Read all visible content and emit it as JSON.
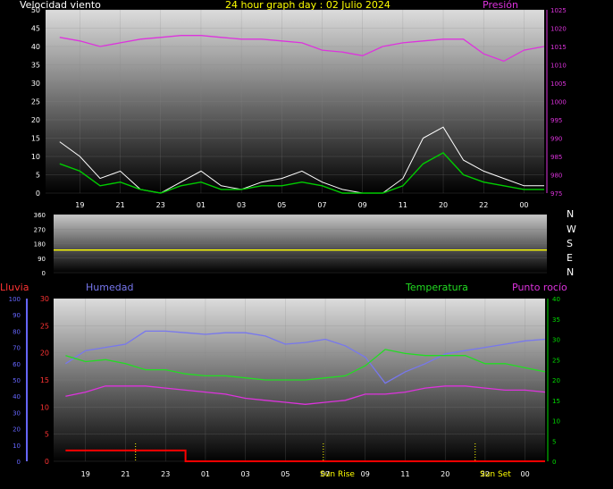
{
  "title": "24 hour graph day : 02 Julio 2024",
  "colors": {
    "wind": "#ffffff",
    "wind_avg": "#00cc00",
    "pressure": "#dd33dd",
    "direction": "#ffff00",
    "rain": "#ff0000",
    "humidity": "#7777ee",
    "temperature": "#22dd22",
    "dewpoint": "#dd33dd",
    "title": "#ffff00",
    "axis_left": "#ffffff",
    "rain_axis": "#ff3333",
    "hum_axis": "#6666ff",
    "temp_axis": "#00dd00"
  },
  "labels": {
    "wind": "Velocidad viento",
    "pressure": "Presión",
    "rain": "Lluvia",
    "humidity": "Humedad",
    "temperature": "Temperatura",
    "dewpoint": "Punto rocío",
    "sunrise": "Sun Rise",
    "sunset": "Sun Set",
    "compass": [
      "N",
      "W",
      "S",
      "E",
      "N"
    ]
  },
  "x_ticks": [
    "19",
    "21",
    "23",
    "01",
    "03",
    "05",
    "07",
    "09",
    "11",
    "20",
    "22",
    "00"
  ],
  "x_ticks_bottom": [
    "19",
    "21",
    "23",
    "01",
    "03",
    "05",
    "07",
    "09",
    "11",
    "20",
    "22",
    "00"
  ],
  "chart_data": [
    {
      "type": "line",
      "name": "wind_pressure",
      "ylabel": "Velocidad viento",
      "y2label": "Presión",
      "ylim": [
        0,
        50
      ],
      "yticks": [
        0,
        5,
        10,
        15,
        20,
        25,
        30,
        35,
        40,
        45,
        50
      ],
      "y2lim": [
        975,
        1025
      ],
      "y2ticks": [
        975,
        980,
        985,
        990,
        995,
        1000,
        1005,
        1010,
        1015,
        1020,
        1025
      ],
      "x_hours": [
        18,
        19,
        20,
        21,
        22,
        23,
        24,
        25,
        26,
        27,
        28,
        29,
        30,
        31,
        32,
        33,
        34,
        35,
        36,
        37,
        38,
        39,
        40,
        41,
        42
      ],
      "series": [
        {
          "key": "pressure",
          "name": "Presión",
          "axis": "right",
          "values": [
            1017.5,
            1016.5,
            1015,
            1016,
            1017,
            1017.5,
            1018,
            1018,
            1017.5,
            1017,
            1017,
            1016.5,
            1016,
            1014,
            1013.5,
            1012.5,
            1015,
            1016,
            1016.5,
            1017,
            1017,
            1013,
            1011,
            1014,
            1015
          ]
        },
        {
          "key": "wind",
          "name": "Velocidad viento",
          "axis": "left",
          "values": [
            14,
            10,
            4,
            6,
            1,
            0,
            3,
            6,
            2,
            1,
            3,
            4,
            6,
            3,
            1,
            0,
            0,
            4,
            15,
            18,
            9,
            6,
            4,
            2,
            2
          ]
        },
        {
          "key": "wind_avg",
          "name": "",
          "axis": "left",
          "values": [
            8,
            6,
            2,
            3,
            1,
            0,
            2,
            3,
            1,
            1,
            2,
            2,
            3,
            2,
            0,
            0,
            0,
            2,
            8,
            11,
            5,
            3,
            2,
            1,
            1
          ]
        }
      ]
    },
    {
      "type": "line",
      "name": "wind_direction",
      "ylim": [
        0,
        360
      ],
      "yticks": [
        0,
        90,
        180,
        270,
        360
      ],
      "series": [
        {
          "key": "direction",
          "name": "",
          "values": [
            140,
            140
          ]
        }
      ]
    },
    {
      "type": "line",
      "name": "temp_hum",
      "ylabel": "Lluvia",
      "ylim": [
        0,
        30
      ],
      "yticks": [
        0,
        5,
        10,
        15,
        20,
        25,
        30
      ],
      "hum_ylim": [
        0,
        100
      ],
      "hum_yticks": [
        0,
        10,
        20,
        30,
        40,
        50,
        60,
        70,
        80,
        90,
        100
      ],
      "y2lim": [
        0,
        40
      ],
      "y2ticks": [
        0,
        5,
        10,
        15,
        20,
        25,
        30,
        35,
        40
      ],
      "x_hours": [
        18,
        19,
        20,
        21,
        22,
        23,
        24,
        25,
        26,
        27,
        28,
        29,
        30,
        31,
        32,
        33,
        34,
        35,
        36,
        37,
        38,
        39,
        40,
        41,
        42
      ],
      "series": [
        {
          "key": "humidity",
          "name": "Humedad",
          "axis": "hum",
          "values": [
            60,
            68,
            70,
            72,
            80,
            80,
            79,
            78,
            79,
            79,
            77,
            72,
            73,
            75,
            71,
            64,
            48,
            55,
            60,
            66,
            68,
            70,
            72,
            74,
            75
          ]
        },
        {
          "key": "temperature",
          "name": "Temperatura",
          "axis": "right",
          "values": [
            26,
            24.5,
            25,
            24,
            22.5,
            22.5,
            21.5,
            21,
            21,
            20.5,
            20,
            20,
            20,
            20.5,
            21,
            23.5,
            27.5,
            26.5,
            26,
            26,
            26,
            24,
            24,
            23,
            22
          ]
        },
        {
          "key": "dewpoint",
          "name": "Punto rocío",
          "axis": "right",
          "values": [
            16,
            17,
            18.5,
            18.5,
            18.5,
            18,
            17.5,
            17,
            16.5,
            15.5,
            15,
            14.5,
            14,
            14.5,
            15,
            16.5,
            16.5,
            17,
            18,
            18.5,
            18.5,
            18,
            17.5,
            17.5,
            17
          ]
        },
        {
          "key": "rain",
          "name": "Lluvia",
          "axis": "left",
          "values": [
            2,
            2,
            2,
            2,
            2,
            2,
            0,
            0,
            0,
            0,
            0,
            0,
            0,
            0,
            0,
            0,
            0,
            0,
            0,
            0,
            0,
            0,
            0,
            0,
            0
          ]
        }
      ]
    }
  ]
}
